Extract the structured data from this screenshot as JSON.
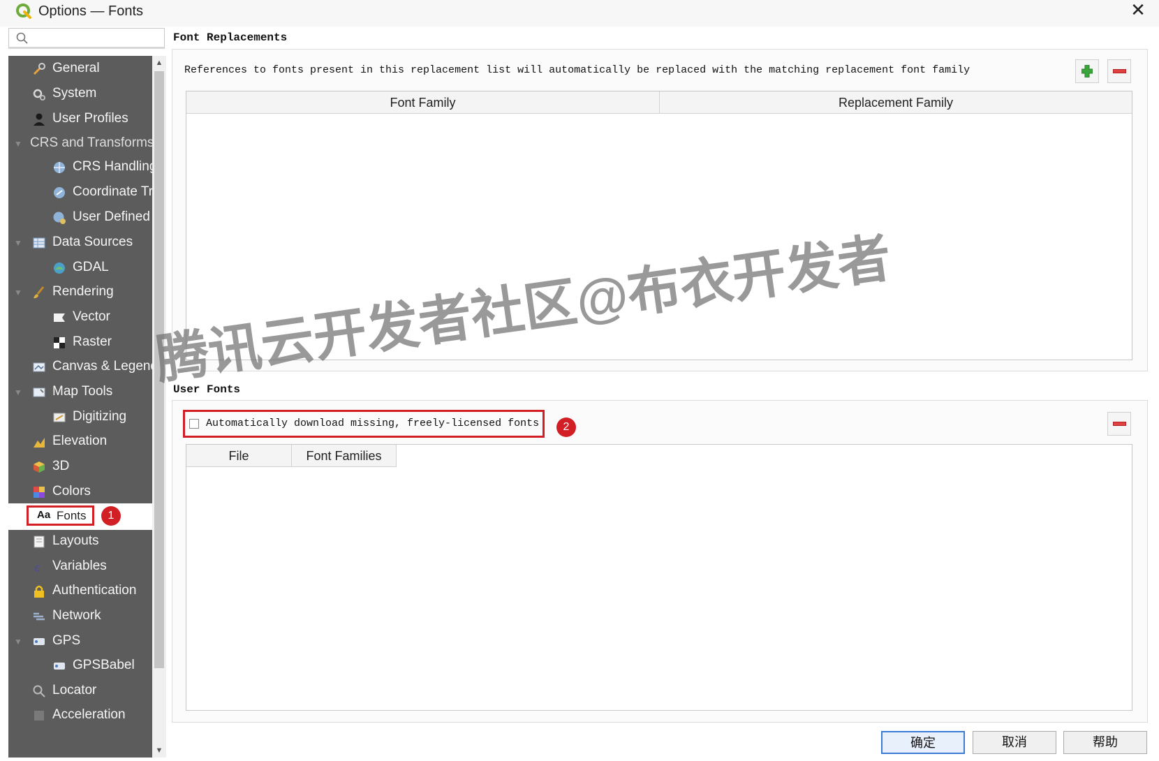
{
  "window": {
    "title": "Options — Fonts",
    "close_glyph": "✕"
  },
  "search": {
    "placeholder": "",
    "value": ""
  },
  "sidebar": {
    "items": [
      {
        "label": "General",
        "icon": "wrench-icon"
      },
      {
        "label": "System",
        "icon": "gears-icon"
      },
      {
        "label": "User Profiles",
        "icon": "user-icon"
      },
      {
        "label": "CRS and Transforms",
        "icon": "",
        "expanded": true
      },
      {
        "label": "CRS Handling",
        "icon": "globe-icon"
      },
      {
        "label": "Coordinate Transforms",
        "icon": "globe-transform-icon"
      },
      {
        "label": "User Defined CRS",
        "icon": "globe-user-icon"
      },
      {
        "label": "Data Sources",
        "icon": "table-icon",
        "expanded": true
      },
      {
        "label": "GDAL",
        "icon": "gdal-icon"
      },
      {
        "label": "Rendering",
        "icon": "brush-icon",
        "expanded": true
      },
      {
        "label": "Vector",
        "icon": "vector-flag-icon"
      },
      {
        "label": "Raster",
        "icon": "raster-checker-icon"
      },
      {
        "label": "Canvas & Legend",
        "icon": "canvas-icon"
      },
      {
        "label": "Map Tools",
        "icon": "map-tools-icon",
        "expanded": true
      },
      {
        "label": "Digitizing",
        "icon": "digitizing-icon"
      },
      {
        "label": "Elevation",
        "icon": "elevation-icon"
      },
      {
        "label": "3D",
        "icon": "cube-icon"
      },
      {
        "label": "Colors",
        "icon": "palette-icon"
      },
      {
        "label": "Fonts",
        "icon": "font-aa-icon",
        "selected": true
      },
      {
        "label": "Layouts",
        "icon": "layout-icon"
      },
      {
        "label": "Variables",
        "icon": "variables-icon"
      },
      {
        "label": "Authentication",
        "icon": "lock-icon"
      },
      {
        "label": "Network",
        "icon": "network-icon"
      },
      {
        "label": "GPS",
        "icon": "gps-icon",
        "expanded": true
      },
      {
        "label": "GPSBabel",
        "icon": "gpsbabel-icon"
      },
      {
        "label": "Locator",
        "icon": "locator-search-icon"
      },
      {
        "label": "Acceleration",
        "icon": "acceleration-icon"
      }
    ],
    "fonts_icon_text": "Aa"
  },
  "annotations": {
    "badge_1": "1",
    "badge_2": "2"
  },
  "font_replacements": {
    "title": "Font Replacements",
    "description": "References to fonts present in this replacement list will automatically be replaced with the matching replacement font family",
    "columns": [
      "Font Family",
      "Replacement Family"
    ],
    "rows": []
  },
  "user_fonts": {
    "title": "User Fonts",
    "auto_download_label": "Automatically download missing, freely-licensed fonts",
    "auto_download_checked": false,
    "columns": [
      "File",
      "Font Families"
    ],
    "rows": []
  },
  "footer": {
    "ok": "确定",
    "cancel": "取消",
    "help": "帮助"
  },
  "watermark": "腾讯云开发者社区@布衣开发者",
  "colors": {
    "sidebar_bg": "#5c5c5c",
    "highlight_red": "#d11f25",
    "add_green": "#3aa53a",
    "remove_red": "#e04040"
  }
}
